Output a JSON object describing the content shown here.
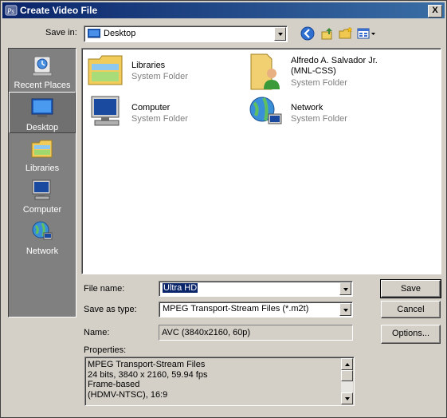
{
  "window": {
    "title": "Create Video File",
    "close_label": "X"
  },
  "toolbar": {
    "save_in_label": "Save in:",
    "save_in_value": "Desktop"
  },
  "places": [
    {
      "label": "Recent Places",
      "icon": "recent-places-icon"
    },
    {
      "label": "Desktop",
      "icon": "desktop-icon",
      "selected": true
    },
    {
      "label": "Libraries",
      "icon": "libraries-icon"
    },
    {
      "label": "Computer",
      "icon": "computer-icon"
    },
    {
      "label": "Network",
      "icon": "network-icon"
    }
  ],
  "files": [
    {
      "name": "Libraries",
      "type": "System Folder",
      "icon": "libraries-folder-icon"
    },
    {
      "name": "Alfredo A. Salvador Jr.\n(MNL-CSS)",
      "type": "System Folder",
      "icon": "user-folder-icon"
    },
    {
      "name": "Computer",
      "type": "System Folder",
      "icon": "computer-icon"
    },
    {
      "name": "Network",
      "type": "System Folder",
      "icon": "network-icon"
    }
  ],
  "form": {
    "file_name_label": "File name:",
    "file_name_value": "Ultra HD",
    "save_type_label": "Save as type:",
    "save_type_value": "MPEG Transport-Stream Files (*.m2t)",
    "name_label": "Name:",
    "name_value": "AVC (3840x2160, 60p)",
    "properties_label": "Properties:",
    "properties_lines": [
      "MPEG Transport-Stream Files",
      "24 bits, 3840 x 2160, 59.94 fps",
      "Frame-based",
      "(HDMV-NTSC), 16:9"
    ]
  },
  "buttons": {
    "save": "Save",
    "cancel": "Cancel",
    "options": "Options..."
  },
  "colors": {
    "title_start": "#0a246a",
    "title_end": "#3a6ea5",
    "face": "#d4d0c8"
  }
}
